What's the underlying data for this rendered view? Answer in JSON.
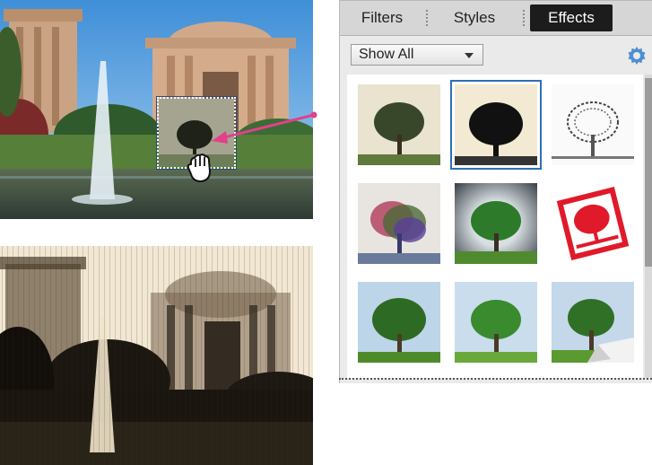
{
  "panel": {
    "tabs": [
      {
        "label": "Filters",
        "active": false
      },
      {
        "label": "Styles",
        "active": false
      },
      {
        "label": "Effects",
        "active": true
      }
    ],
    "filter_dropdown": {
      "value": "Show All"
    },
    "settings_icon": "gear-icon",
    "effects": [
      {
        "style": "color-vintage",
        "selected": false
      },
      {
        "style": "black-ink",
        "selected": true
      },
      {
        "style": "pencil-sketch",
        "selected": false
      },
      {
        "style": "rgb-split",
        "selected": false
      },
      {
        "style": "dark-vignette",
        "selected": false
      },
      {
        "style": "red-stamp",
        "selected": false
      },
      {
        "style": "natural",
        "selected": false
      },
      {
        "style": "bright",
        "selected": false
      },
      {
        "style": "page-curl",
        "selected": false
      }
    ]
  },
  "colors": {
    "accent_selection": "#2f6fb6",
    "drag_arrow": "#e2408a",
    "active_tab_bg": "#1c1c1c"
  },
  "icons": {
    "cursor": "hand-grab-icon",
    "dropdown": "chevron-down-icon"
  }
}
